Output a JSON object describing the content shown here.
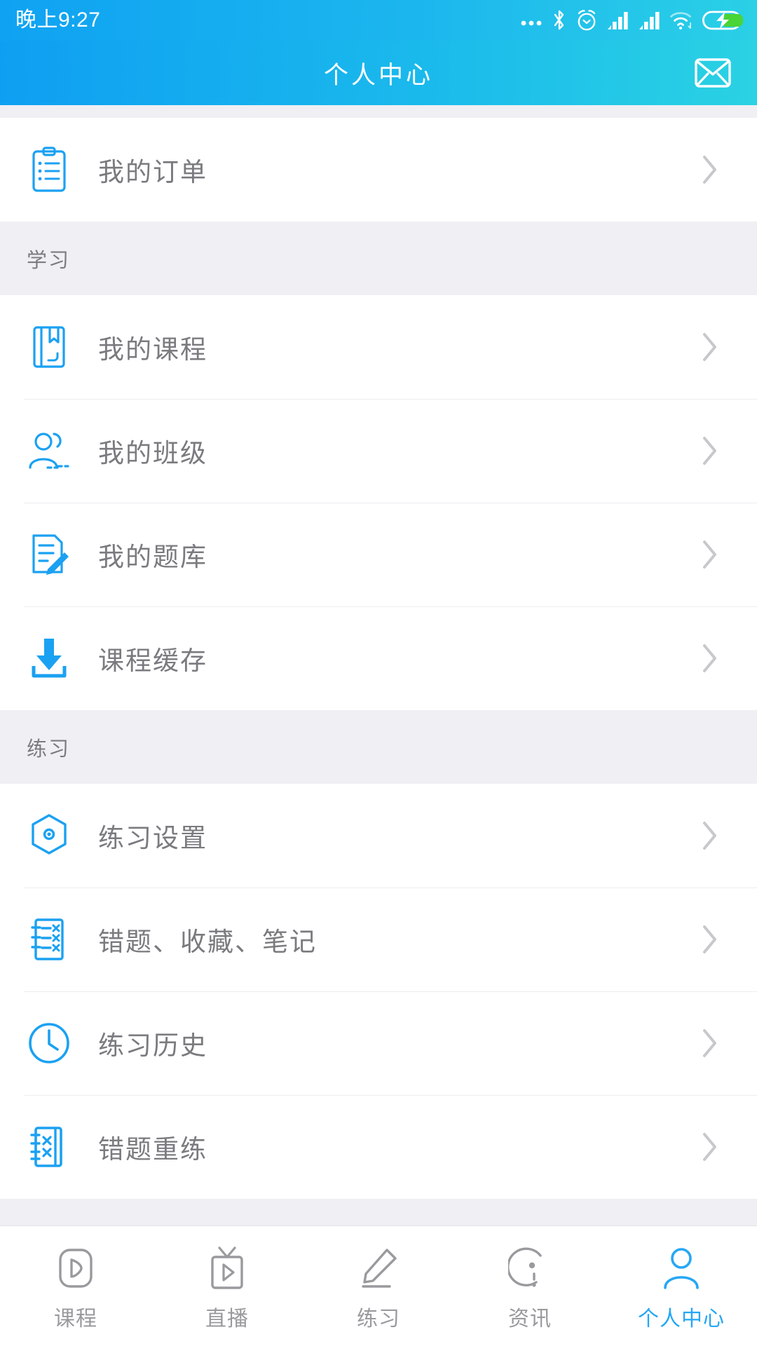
{
  "status_bar": {
    "time": "晚上9:27",
    "icons": [
      "more-dots-icon",
      "bluetooth-icon",
      "alarm-clock-icon",
      "signal-bars-icon",
      "signal-bars-icon",
      "wifi-icon",
      "battery-charging-icon"
    ]
  },
  "header": {
    "title": "个人中心",
    "mail_icon": "envelope-icon"
  },
  "colors": {
    "header_gradient_start": "#0f9ff2",
    "header_gradient_end": "#2ad2e3",
    "accent_blue": "#27a8f5",
    "icon_blue": "#1ba1f2",
    "label_gray": "#7a7a7f",
    "section_bg": "#efeff4",
    "tab_inactive": "#9a9a9e"
  },
  "groups": [
    {
      "section": null,
      "items": [
        {
          "label": "我的订单",
          "icon": "clipboard-list-icon",
          "chevron": "chevron-right-icon"
        }
      ]
    },
    {
      "section": "学习",
      "items": [
        {
          "label": "我的课程",
          "icon": "book-bookmark-icon",
          "chevron": "chevron-right-icon"
        },
        {
          "label": "我的班级",
          "icon": "people-group-icon",
          "chevron": "chevron-right-icon"
        },
        {
          "label": "我的题库",
          "icon": "document-pencil-icon",
          "chevron": "chevron-right-icon"
        },
        {
          "label": "课程缓存",
          "icon": "download-icon",
          "chevron": "chevron-right-icon"
        }
      ]
    },
    {
      "section": "练习",
      "items": [
        {
          "label": "练习设置",
          "icon": "hexagon-gear-icon",
          "chevron": "chevron-right-icon"
        },
        {
          "label": "错题、收藏、笔记",
          "icon": "notebook-x-icon",
          "chevron": "chevron-right-icon"
        },
        {
          "label": "练习历史",
          "icon": "clock-icon",
          "chevron": "chevron-right-icon"
        },
        {
          "label": "错题重练",
          "icon": "spiral-notebook-x-icon",
          "chevron": "chevron-right-icon"
        }
      ]
    }
  ],
  "tabbar": {
    "items": [
      {
        "label": "课程",
        "icon": "video-play-icon",
        "active": false
      },
      {
        "label": "直播",
        "icon": "tv-live-icon",
        "active": false
      },
      {
        "label": "练习",
        "icon": "pencil-icon",
        "active": false
      },
      {
        "label": "资讯",
        "icon": "news-icon",
        "active": false
      },
      {
        "label": "个人中心",
        "icon": "person-icon",
        "active": true
      }
    ]
  }
}
